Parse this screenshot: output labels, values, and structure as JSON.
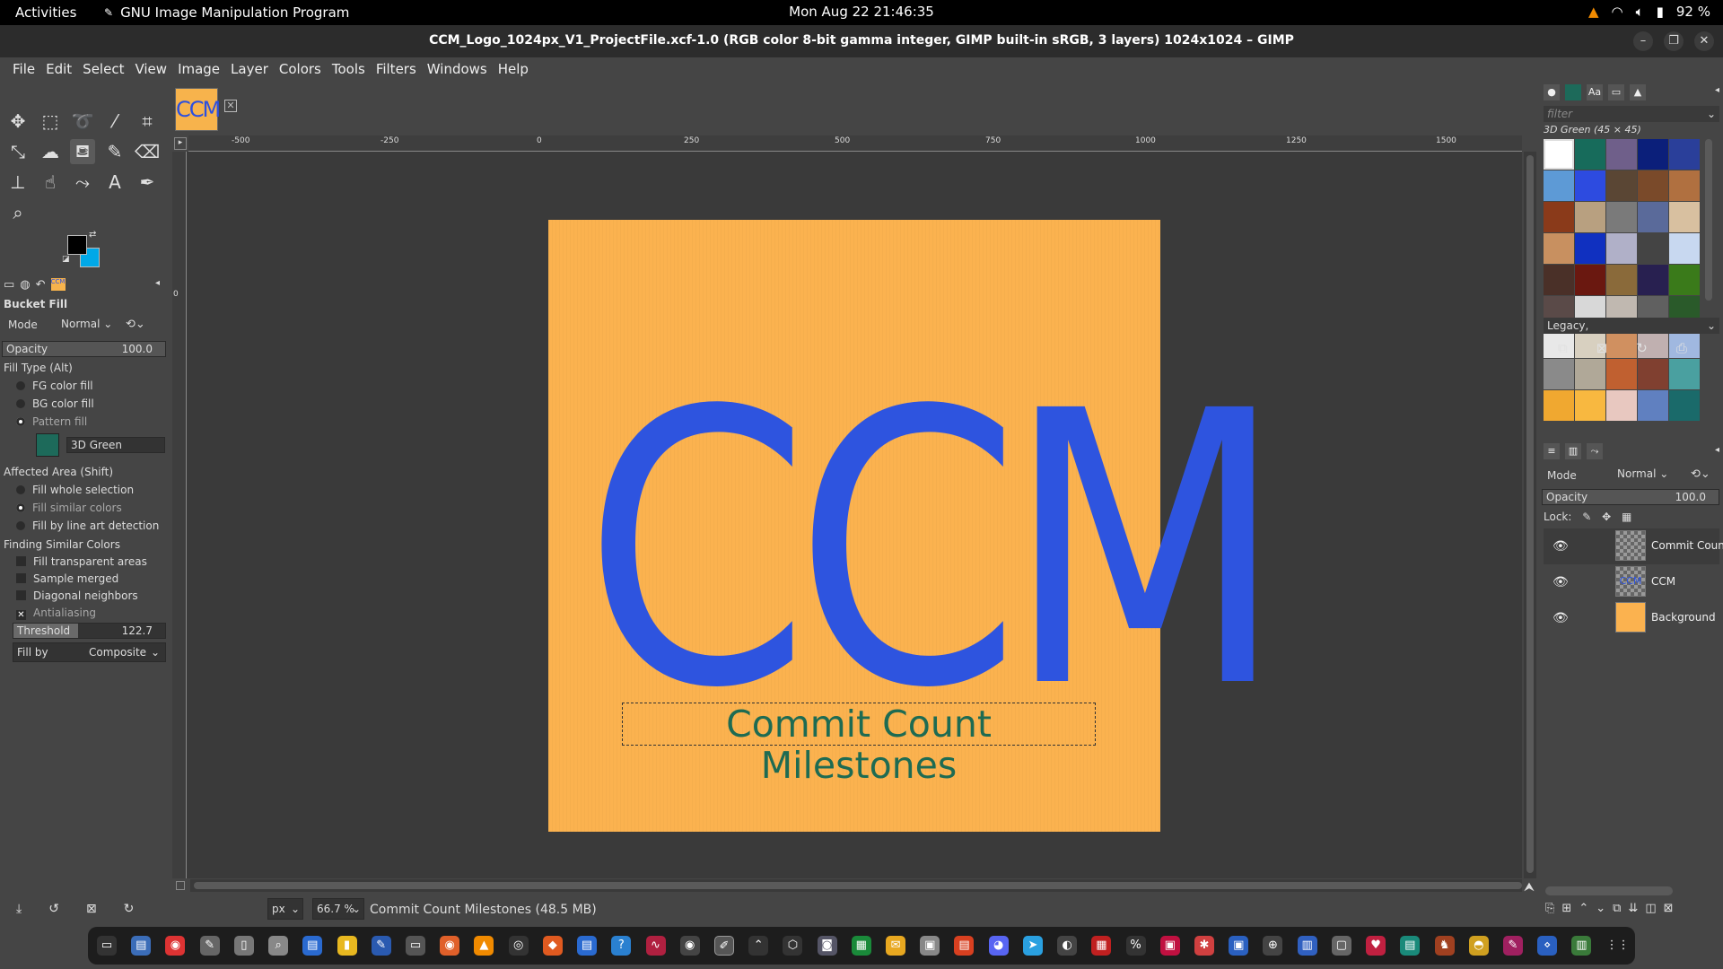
{
  "topbar": {
    "activities": "Activities",
    "app_name": "GNU Image Manipulation Program",
    "clock": "Mon Aug 22  21:46:35",
    "battery": "92 %"
  },
  "window": {
    "title": "CCM_Logo_1024px_V1_ProjectFile.xcf-1.0 (RGB color 8-bit gamma integer, GIMP built-in sRGB, 3 layers) 1024x1024 – GIMP"
  },
  "menubar": [
    "File",
    "Edit",
    "Select",
    "View",
    "Image",
    "Layer",
    "Colors",
    "Tools",
    "Filters",
    "Windows",
    "Help"
  ],
  "colors": {
    "foreground": "#000000",
    "background": "#00a8e8",
    "image_bg": "#fbb24f",
    "logo_text": "#2e54df",
    "subtitle_text": "#1e6b52"
  },
  "tool_options": {
    "title": "Bucket Fill",
    "mode_label": "Mode",
    "mode_value": "Normal",
    "opacity_label": "Opacity",
    "opacity_value": "100.0",
    "fill_type_label": "Fill Type  (Alt)",
    "fill_types": [
      "FG color fill",
      "BG color fill",
      "Pattern fill"
    ],
    "pattern_name": "3D Green",
    "affected_area_label": "Affected Area  (Shift)",
    "affected_areas": [
      "Fill whole selection",
      "Fill similar colors",
      "Fill by line art detection"
    ],
    "finding_label": "Finding Similar Colors",
    "finding_options": [
      "Fill transparent areas",
      "Sample merged",
      "Diagonal neighbors",
      "Antialiasing"
    ],
    "threshold_label": "Threshold",
    "threshold_value": "122.7",
    "fill_by_label": "Fill by",
    "fill_by_value": "Composite"
  },
  "ruler": {
    "labels": [
      "-500",
      "-250",
      "0",
      "250",
      "500",
      "750",
      "1000",
      "1250",
      "1500"
    ]
  },
  "canvas": {
    "tab_thumb_text": "CCM",
    "logo_text": "CCM",
    "subtitle": "Commit Count Milestones"
  },
  "status": {
    "unit": "px",
    "zoom": "66.7 %",
    "message": "Commit Count Milestones (48.5 MB)"
  },
  "patterns": {
    "filter_placeholder": "filter",
    "selected_label": "3D Green (45 × 45)",
    "tag_value": "Legacy,"
  },
  "layers": {
    "mode_label": "Mode",
    "mode_value": "Normal",
    "opacity_label": "Opacity",
    "opacity_value": "100.0",
    "lock_label": "Lock:",
    "items": [
      {
        "name": "Commit Count"
      },
      {
        "name": "CCM"
      },
      {
        "name": "Background"
      }
    ]
  },
  "icons": {
    "dock": [
      "terminal-icon",
      "files-icon",
      "chrome-icon",
      "editor-icon",
      "docs-icon",
      "screenshot-icon",
      "writer-icon",
      "notes-icon",
      "text-icon",
      "settings-icon",
      "firefox-icon",
      "vlc-icon",
      "obs-icon",
      "software-icon",
      "calc-icon",
      "help-icon",
      "monitor-icon",
      "camera-icon",
      "gimp-icon",
      "up-icon",
      "box-icon",
      "disk-icon",
      "sheet-icon",
      "mail-icon",
      "archive-icon",
      "pdf-icon",
      "discord-icon",
      "telegram-icon",
      "steam-icon",
      "calendar-icon",
      "percent-icon",
      "media-icon",
      "paint-icon",
      "video-icon",
      "network-icon",
      "book-icon",
      "folder-icon",
      "heart-icon",
      "chat-icon",
      "game-icon",
      "fish-icon",
      "design-icon",
      "code-icon",
      "trash-icon",
      "apps-grid-icon"
    ]
  }
}
